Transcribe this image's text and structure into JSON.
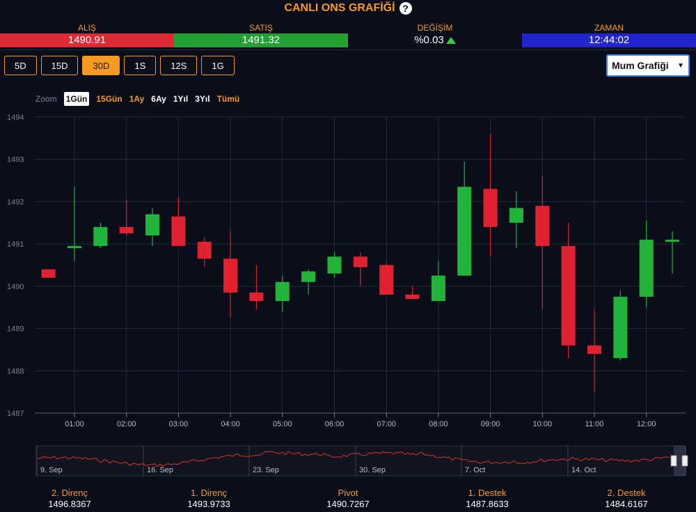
{
  "header": {
    "title": "CANLI ONS GRAFİĞİ",
    "help": "?"
  },
  "quotes": [
    {
      "label": "ALIŞ",
      "value": "1490.91",
      "cls": "q-sell"
    },
    {
      "label": "SATIŞ",
      "value": "1491.32",
      "cls": "q-buy"
    },
    {
      "label": "DEĞİŞİM",
      "value": "%0.03",
      "cls": "q-change"
    },
    {
      "label": "ZAMAN",
      "value": "12:44:02",
      "cls": "q-time"
    }
  ],
  "periods": [
    "5D",
    "15D",
    "30D",
    "1S",
    "12S",
    "1G"
  ],
  "active_period": "30D",
  "chart_type_select": "Mum Grafiği",
  "zoom": {
    "label": "Zoom",
    "options": [
      {
        "text": "1Gün",
        "style": "active"
      },
      {
        "text": "15Gün",
        "style": "orange"
      },
      {
        "text": "1Ay",
        "style": "orange"
      },
      {
        "text": "6Ay",
        "style": "white"
      },
      {
        "text": "1Yıl",
        "style": "white"
      },
      {
        "text": "3Yıl",
        "style": "white"
      },
      {
        "text": "Tümü",
        "style": "orange"
      }
    ]
  },
  "colors": {
    "up": "#23b33a",
    "down": "#e0212f",
    "grid": "#262c3c",
    "navigator_line": "#e03030"
  },
  "chart_data": {
    "type": "candlestick",
    "y_range": [
      1487,
      1494
    ],
    "y_ticks": [
      "1494",
      "1493",
      "1492",
      "1491",
      "1490",
      "1489",
      "1488",
      "1487"
    ],
    "x_ticks": [
      "01:00",
      "02:00",
      "03:00",
      "04:00",
      "05:00",
      "06:00",
      "07:00",
      "08:00",
      "09:00",
      "10:00",
      "11:00",
      "12:00"
    ],
    "time_range_hours": [
      0.3,
      12.5
    ],
    "candles": [
      {
        "t": 0.5,
        "o": 1490.4,
        "h": 1490.4,
        "l": 1490.2,
        "c": 1490.2
      },
      {
        "t": 1.0,
        "o": 1490.9,
        "h": 1492.35,
        "l": 1490.6,
        "c": 1490.95
      },
      {
        "t": 1.5,
        "o": 1490.95,
        "h": 1491.5,
        "l": 1490.9,
        "c": 1491.4
      },
      {
        "t": 2.0,
        "o": 1491.4,
        "h": 1492.05,
        "l": 1491.2,
        "c": 1491.25
      },
      {
        "t": 2.5,
        "o": 1491.2,
        "h": 1491.85,
        "l": 1490.95,
        "c": 1491.7
      },
      {
        "t": 3.0,
        "o": 1491.65,
        "h": 1492.1,
        "l": 1490.95,
        "c": 1490.95
      },
      {
        "t": 3.5,
        "o": 1491.05,
        "h": 1491.15,
        "l": 1490.45,
        "c": 1490.65
      },
      {
        "t": 4.0,
        "o": 1490.65,
        "h": 1491.3,
        "l": 1489.25,
        "c": 1489.85
      },
      {
        "t": 4.5,
        "o": 1489.85,
        "h": 1490.5,
        "l": 1489.45,
        "c": 1489.65
      },
      {
        "t": 5.0,
        "o": 1489.65,
        "h": 1490.25,
        "l": 1489.4,
        "c": 1490.1
      },
      {
        "t": 5.5,
        "o": 1490.1,
        "h": 1490.4,
        "l": 1489.8,
        "c": 1490.35
      },
      {
        "t": 6.0,
        "o": 1490.3,
        "h": 1490.8,
        "l": 1490.2,
        "c": 1490.7
      },
      {
        "t": 6.5,
        "o": 1490.7,
        "h": 1490.8,
        "l": 1490.0,
        "c": 1490.45
      },
      {
        "t": 7.0,
        "o": 1490.5,
        "h": 1490.55,
        "l": 1489.8,
        "c": 1489.8
      },
      {
        "t": 7.5,
        "o": 1489.8,
        "h": 1490.0,
        "l": 1489.7,
        "c": 1489.7
      },
      {
        "t": 8.0,
        "o": 1489.65,
        "h": 1490.6,
        "l": 1489.65,
        "c": 1490.25
      },
      {
        "t": 8.5,
        "o": 1490.25,
        "h": 1492.95,
        "l": 1490.25,
        "c": 1492.35
      },
      {
        "t": 9.0,
        "o": 1492.3,
        "h": 1493.6,
        "l": 1490.7,
        "c": 1491.4
      },
      {
        "t": 9.5,
        "o": 1491.5,
        "h": 1492.25,
        "l": 1490.9,
        "c": 1491.85
      },
      {
        "t": 10.0,
        "o": 1491.9,
        "h": 1492.6,
        "l": 1489.45,
        "c": 1490.95
      },
      {
        "t": 10.5,
        "o": 1490.95,
        "h": 1491.5,
        "l": 1488.3,
        "c": 1488.6
      },
      {
        "t": 11.0,
        "o": 1488.6,
        "h": 1489.45,
        "l": 1487.5,
        "c": 1488.4
      },
      {
        "t": 11.5,
        "o": 1488.3,
        "h": 1489.9,
        "l": 1488.25,
        "c": 1489.75
      },
      {
        "t": 12.0,
        "o": 1489.75,
        "h": 1491.55,
        "l": 1489.5,
        "c": 1491.1
      },
      {
        "t": 12.5,
        "o": 1491.05,
        "h": 1491.3,
        "l": 1490.3,
        "c": 1491.1
      }
    ],
    "navigator": {
      "labels": [
        "9. Sep",
        "16. Sep",
        "23. Sep",
        "30. Sep",
        "7. Oct",
        "14. Oct"
      ]
    }
  },
  "levels": [
    {
      "name": "2. Direnç",
      "value": "1496.8367"
    },
    {
      "name": "1. Direnç",
      "value": "1493.9733"
    },
    {
      "name": "Pivot",
      "value": "1490.7267"
    },
    {
      "name": "1. Destek",
      "value": "1487.8633"
    },
    {
      "name": "2. Destek",
      "value": "1484.6167"
    }
  ]
}
